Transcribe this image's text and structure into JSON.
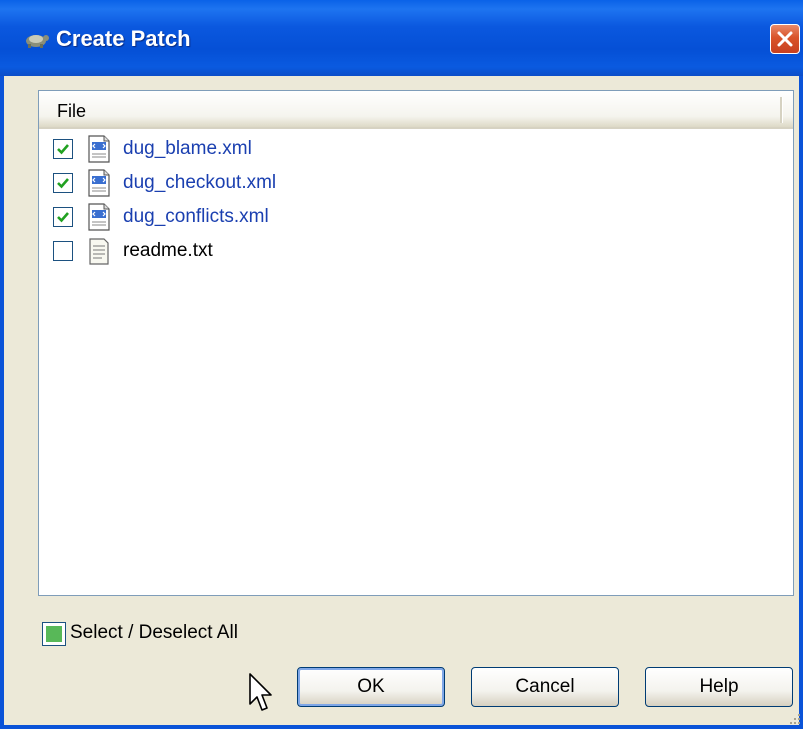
{
  "window": {
    "title": "Create Patch",
    "close_icon": "close-icon",
    "app_icon": "tortoise-icon"
  },
  "file_list": {
    "column_header": "File",
    "items": [
      {
        "name": "dug_blame.xml",
        "checked": true,
        "icon": "xml-file-icon",
        "color": "#1a3fb0"
      },
      {
        "name": "dug_checkout.xml",
        "checked": true,
        "icon": "xml-file-icon",
        "color": "#1a3fb0"
      },
      {
        "name": "dug_conflicts.xml",
        "checked": true,
        "icon": "xml-file-icon",
        "color": "#1a3fb0"
      },
      {
        "name": "readme.txt",
        "checked": false,
        "icon": "text-file-icon",
        "color": "#000000"
      }
    ]
  },
  "select_all": {
    "label": "Select / Deselect All",
    "state": "indeterminate"
  },
  "buttons": {
    "ok": "OK",
    "cancel": "Cancel",
    "help": "Help"
  },
  "colors": {
    "titlebar": "#0550d6",
    "check": "#21a121",
    "modified_text": "#1a3fb0"
  }
}
